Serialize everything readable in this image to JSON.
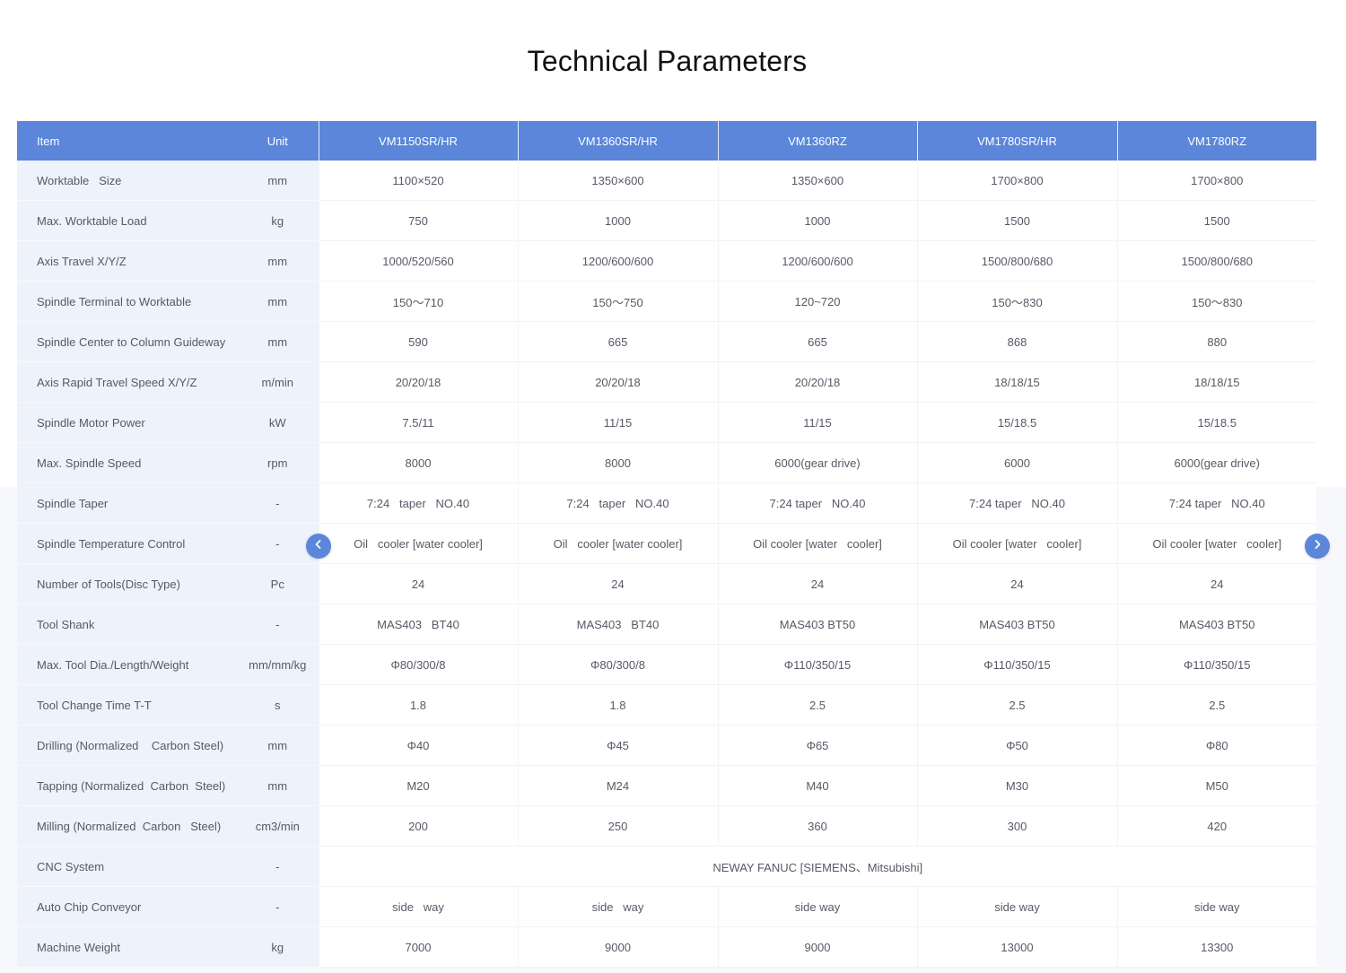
{
  "title": "Technical Parameters",
  "header": {
    "item": "Item",
    "unit": "Unit",
    "models": [
      "VM1150SR/HR",
      "VM1360SR/HR",
      "VM1360RZ",
      "VM1780SR/HR",
      "VM1780RZ"
    ]
  },
  "rows": [
    {
      "item": "Worktable   Size",
      "unit": "mm",
      "values": [
        "1100×520",
        "1350×600",
        "1350×600",
        "1700×800",
        "1700×800"
      ]
    },
    {
      "item": "Max. Worktable Load",
      "unit": "kg",
      "values": [
        "750",
        "1000",
        "1000",
        "1500",
        "1500"
      ]
    },
    {
      "item": "Axis Travel X/Y/Z",
      "unit": "mm",
      "values": [
        "1000/520/560",
        "1200/600/600",
        "1200/600/600",
        "1500/800/680",
        "1500/800/680"
      ]
    },
    {
      "item": "Spindle Terminal to Worktable",
      "unit": "mm",
      "values": [
        "150～710",
        "150～750",
        "120~720",
        "150～830",
        "150～830"
      ]
    },
    {
      "item": "Spindle Center to Column Guideway",
      "unit": "mm",
      "values": [
        "590",
        "665",
        "665",
        "868",
        "880"
      ]
    },
    {
      "item": "Axis Rapid Travel Speed X/Y/Z",
      "unit": "m/min",
      "values": [
        "20/20/18",
        "20/20/18",
        "20/20/18",
        "18/18/15",
        "18/18/15"
      ]
    },
    {
      "item": "Spindle Motor Power",
      "unit": "kW",
      "values": [
        "7.5/11",
        "11/15",
        "11/15",
        "15/18.5",
        "15/18.5"
      ]
    },
    {
      "item": "Max. Spindle Speed",
      "unit": "rpm",
      "values": [
        "8000",
        "8000",
        "6000(gear drive)",
        "6000",
        "6000(gear drive)"
      ]
    },
    {
      "item": "Spindle Taper",
      "unit": "-",
      "values": [
        "7:24   taper   NO.40",
        "7:24   taper   NO.40",
        "7:24 taper   NO.40",
        "7:24 taper   NO.40",
        "7:24 taper   NO.40"
      ]
    },
    {
      "item": "Spindle Temperature Control",
      "unit": "-",
      "values": [
        "Oil   cooler [water cooler]",
        "Oil   cooler [water cooler]",
        "Oil cooler [water   cooler]",
        "Oil cooler [water   cooler]",
        "Oil cooler [water   cooler]"
      ]
    },
    {
      "item": "Number of Tools(Disc Type)",
      "unit": "Pc",
      "values": [
        "24",
        "24",
        "24",
        "24",
        "24"
      ]
    },
    {
      "item": "Tool Shank",
      "unit": "-",
      "values": [
        "MAS403   BT40",
        "MAS403   BT40",
        "MAS403 BT50",
        "MAS403 BT50",
        "MAS403 BT50"
      ]
    },
    {
      "item": "Max. Tool Dia./Length/Weight",
      "unit": "mm/mm/kg",
      "values": [
        "Φ80/300/8",
        "Φ80/300/8",
        "Φ110/350/15",
        "Φ110/350/15",
        "Φ110/350/15"
      ]
    },
    {
      "item": "Tool Change Time T-T",
      "unit": "s",
      "values": [
        "1.8",
        "1.8",
        "2.5",
        "2.5",
        "2.5"
      ]
    },
    {
      "item": "Drilling (Normalized    Carbon Steel)",
      "unit": "mm",
      "values": [
        "Φ40",
        "Φ45",
        "Φ65",
        "Φ50",
        "Φ80"
      ]
    },
    {
      "item": "Tapping (Normalized  Carbon  Steel)",
      "unit": "mm",
      "values": [
        "M20",
        "M24",
        "M40",
        "M30",
        "M50"
      ]
    },
    {
      "item": "Milling (Normalized  Carbon   Steel)",
      "unit": "cm3/min",
      "values": [
        "200",
        "250",
        "360",
        "300",
        "420"
      ]
    },
    {
      "item": "CNC System",
      "unit": "-",
      "span_value": "NEWAY FANUC [SIEMENS、Mitsubishi]"
    },
    {
      "item": "Auto Chip Conveyor",
      "unit": "-",
      "values": [
        "side   way",
        "side   way",
        "side way",
        "side way",
        "side way"
      ]
    },
    {
      "item": "Machine Weight",
      "unit": "kg",
      "values": [
        "7000",
        "9000",
        "9000",
        "13000",
        "13300"
      ]
    }
  ],
  "nav": {
    "prev_icon": "chevron-left-icon",
    "next_icon": "chevron-right-icon"
  },
  "colors": {
    "header_bg": "#5b86d9",
    "item_col_bg": "#eef2fa",
    "title": "#111111",
    "text": "#555a66"
  }
}
